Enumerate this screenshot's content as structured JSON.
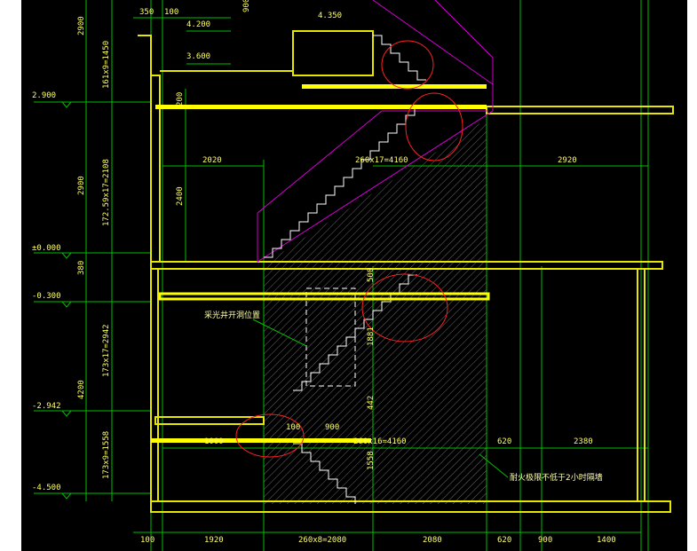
{
  "drawing": {
    "colors": {
      "background": "#000000",
      "frame": "#ffffff",
      "dimension_line": "#00ff00",
      "wall": "#ffff00",
      "stair_outline": "#ff00ff",
      "hatch": "#808080",
      "highlight_bar": "#ffff00",
      "annotation_circle": "#ff2020",
      "text": "#ffff66",
      "text_cn": "#ffffaa"
    },
    "elevations": {
      "e1": "2.900",
      "e2": "±0.000",
      "e3": "-0.300",
      "e4": "-2.942",
      "e5": "-4.500",
      "e6": "4.350",
      "e7": "4.200",
      "e8": "3.600"
    },
    "dimensions": {
      "d_350": "350",
      "d_100a": "100",
      "d_900a": "900",
      "d_2900a": "2900",
      "d_1650": "161x9=1450",
      "d_2900b": "2900",
      "d_2108": "172.59x17=2108",
      "d_200": "200",
      "d_2400": "2400",
      "d_2020": "2020",
      "d_260x17": "260x17=4160",
      "d_2920": "2920",
      "d_380": "380",
      "d_500": "500",
      "d_2942": "173x17=2942",
      "d_4200": "4200",
      "d_1881": "1881",
      "d_442": "442",
      "d_1558": "173x9=1558",
      "d_1558b": "1558",
      "d_100b": "100",
      "d_900b": "900",
      "d_1000": "1000",
      "d_260b": "260x16=4160",
      "d_620a": "620",
      "d_2380": "2380",
      "b_100": "100",
      "b_1920": "1920",
      "b_2080": "260x8=2080",
      "b_2080b": "2080",
      "b_620": "620",
      "b_900": "900",
      "b_1400": "1400"
    },
    "notes": {
      "skylight": "采光井开洞位置",
      "fire_wall": "耐火极限不低于2小时隔墙"
    }
  }
}
